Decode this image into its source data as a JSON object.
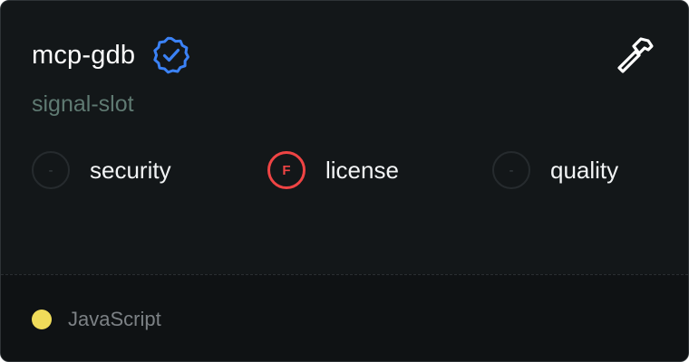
{
  "card": {
    "title": "mcp-gdb",
    "author": "signal-slot",
    "verified_icon": "verified-badge-icon",
    "tool_icon": "hammer-icon"
  },
  "scores": [
    {
      "grade": "-",
      "label": "security",
      "status": "neutral"
    },
    {
      "grade": "F",
      "label": "license",
      "status": "fail"
    },
    {
      "grade": "-",
      "label": "quality",
      "status": "neutral"
    }
  ],
  "footer": {
    "language": "JavaScript",
    "language_color": "#f0dc5a"
  },
  "colors": {
    "background": "#131719",
    "verified": "#3b82f6",
    "fail": "#ef4444",
    "author": "#5f7a72"
  }
}
